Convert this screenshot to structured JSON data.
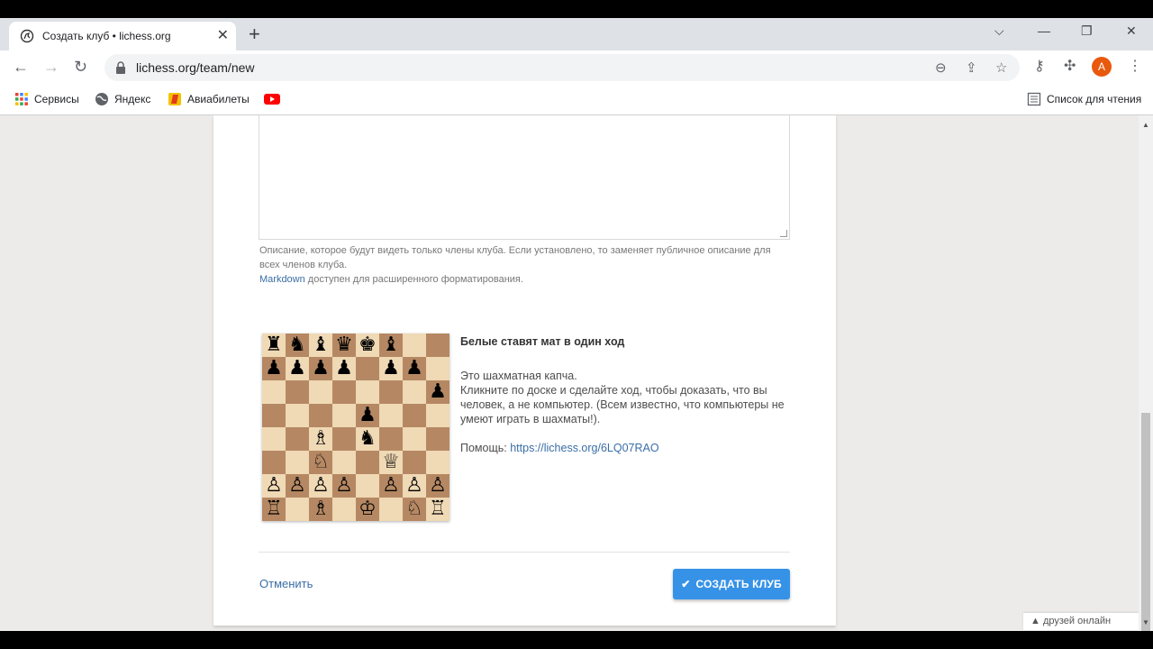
{
  "tab": {
    "title": "Создать клуб • lichess.org",
    "close": "✕"
  },
  "newtab": "+",
  "window": {
    "dropdown": "⌵",
    "minimize": "—",
    "restore": "❐",
    "close": "✕"
  },
  "nav": {
    "back": "←",
    "forward": "→",
    "reload": "↻"
  },
  "address": {
    "url": "lichess.org/team/new"
  },
  "toolbar_icons": {
    "zoom": "⊖",
    "share": "⇪",
    "bookmark": "☆",
    "key": "⚷",
    "extensions": "✣",
    "menu": "⋮"
  },
  "profile": {
    "initial": "A",
    "color": "#e8590c"
  },
  "bookmarks": [
    {
      "label": "Сервисы",
      "icon": "apps-grid-icon"
    },
    {
      "label": "Яндекс",
      "icon": "globe-icon"
    },
    {
      "label": "Авиабилеты",
      "icon": "aviasales-icon"
    },
    {
      "label": "",
      "icon": "youtube-icon"
    }
  ],
  "reading_list": "Список для чтения",
  "form": {
    "help_line": "Описание, которое будут видеть только члены клуба. Если установлено, то заменяет публичное описание для всех членов клуба.",
    "markdown_link": "Markdown",
    "markdown_rest": " доступен для расширенного форматирования."
  },
  "captcha": {
    "title": "Белые ставят мат в один ход",
    "line1": "Это шахматная капча.",
    "line2": "Кликните по доске и сделайте ход, чтобы доказать, что вы человек, а не компьютер. (Всем известно, что компьютеры не умеют играть в шахматы!).",
    "help_label": "Помощь: ",
    "help_link": "https://lichess.org/6LQ07RAO",
    "board": [
      [
        "♜",
        "♞",
        "♝",
        "♛",
        "♚",
        "♝",
        "",
        ""
      ],
      [
        "♟",
        "♟",
        "♟",
        "♟",
        "",
        "♟",
        "♟",
        ""
      ],
      [
        "",
        "",
        "",
        "",
        "",
        "",
        "",
        "♟"
      ],
      [
        "",
        "",
        "",
        "",
        "♟",
        "",
        "",
        ""
      ],
      [
        "",
        "",
        "♗",
        "",
        "♞",
        "",
        "",
        ""
      ],
      [
        "",
        "",
        "♘",
        "",
        "",
        "♕",
        "",
        ""
      ],
      [
        "♙",
        "♙",
        "♙",
        "♙",
        "",
        "♙",
        "♙",
        "♙"
      ],
      [
        "♖",
        "",
        "♗",
        "",
        "♔",
        "",
        "♘",
        "♖"
      ]
    ]
  },
  "actions": {
    "cancel": "Отменить",
    "submit": "СОЗДАТЬ КЛУБ",
    "check": "✔"
  },
  "friends": "▲ друзей онлайн",
  "colors": {
    "accent": "#3692e7",
    "link": "#3a6ea5"
  }
}
